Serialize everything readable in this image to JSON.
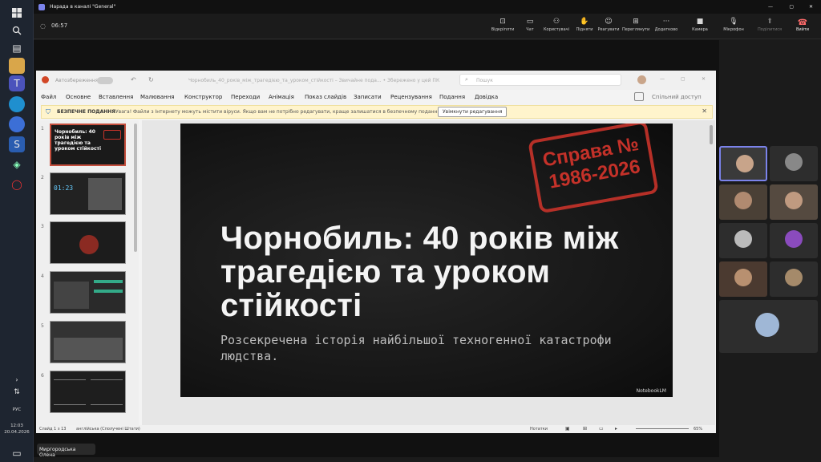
{
  "taskbar": {
    "language": "РУС",
    "time": "12:03",
    "date": "20.04.2026"
  },
  "titlebar": {
    "title": "Нарада в каналі \"General\""
  },
  "toolbar": {
    "timer": "06:57",
    "buttons": [
      "Відкріплти",
      "Чат",
      "Користувачі",
      "Підняти",
      "Реагувати",
      "Переглянути",
      "Додатково",
      "Камера",
      "Мікрофон",
      "Поділитися"
    ],
    "leave": "Вийти"
  },
  "powerpoint": {
    "autosave": "Автозбереження",
    "doc_title": "Чорнобиль_40_років_між_трагедією_та_уроком_стійкості – Звичайне пода... • Збережено у цей ПК",
    "search_placeholder": "Пошук",
    "share": "Спільний доступ",
    "menu": [
      "Файл",
      "Основне",
      "Вставлення",
      "Малювання",
      "Конструктор",
      "Переходи",
      "Анімація",
      "Показ слайдів",
      "Записати",
      "Рецензування",
      "Подання",
      "Довідка"
    ],
    "warning_label": "БЕЗПЕЧНЕ ПОДАННЯ",
    "warning_text": "Увага! Файли з Інтернету можуть містити віруси. Якщо вам не потрібно редагувати, краще залишатися в безпечному поданні.",
    "warning_button": "Увімкнути редагування",
    "thumbnails": [
      "1",
      "2",
      "3",
      "4",
      "5",
      "6"
    ],
    "thumb1_title": "Чорнобиль: 40 років між трагедією та уроком стійкості",
    "status_slide": "Слайд 1 з 13",
    "status_lang": "англійська (Сполучені Штати)",
    "status_notes": "Нотатки",
    "zoom": "65%"
  },
  "slide": {
    "stamp_line1": "Справа №",
    "stamp_line2": "1986-2026",
    "title": "Чорнобиль: 40 років між трагедією та уроком стійкості",
    "subtitle": "Розсекречена історія найбільшої техногенної катастрофи людства.",
    "watermark": "NotebookLM"
  },
  "presenter_name": "Миргородська Олена",
  "colors": {
    "accent_red": "#c8332a",
    "warning_bg": "#fff4cc",
    "teams_bg": "#1b1b1b"
  }
}
